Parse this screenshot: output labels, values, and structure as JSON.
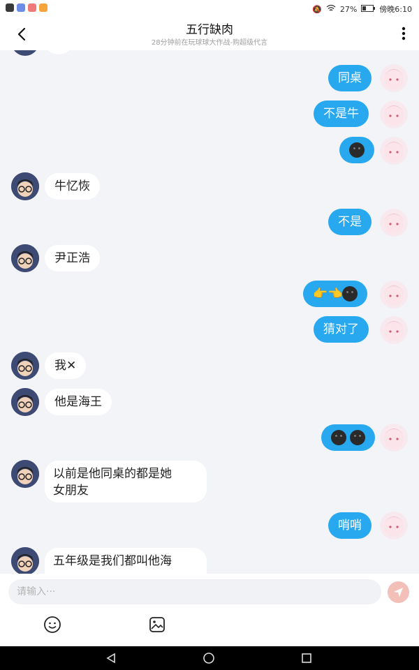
{
  "status_bar": {
    "battery": "27%",
    "clock": "傍晚6:10"
  },
  "header": {
    "title": "五行缺肉",
    "subtitle": "28分钟前在玩球球大作战-购超级代言"
  },
  "messages": [
    {
      "side": "right",
      "text": "同桌"
    },
    {
      "side": "right",
      "text": "不是牛"
    },
    {
      "side": "right",
      "text": "",
      "emoji": [
        "dark-face"
      ]
    },
    {
      "side": "left",
      "text": "牛忆恢"
    },
    {
      "side": "right",
      "text": "不是"
    },
    {
      "side": "left",
      "text": "尹正浩"
    },
    {
      "side": "right",
      "text": "👉👈",
      "emoji": [
        "dark-face"
      ]
    },
    {
      "side": "right",
      "text": "猜对了"
    },
    {
      "side": "left",
      "text": "我✕"
    },
    {
      "side": "left",
      "text": "他是海王"
    },
    {
      "side": "right",
      "text": "",
      "emoji": [
        "dark-face",
        "dark-face"
      ]
    },
    {
      "side": "left",
      "text": "以前是他同桌的都是她",
      "text2": "女朋友"
    },
    {
      "side": "right",
      "text": "哨哨"
    },
    {
      "side": "left",
      "text": "五年级是我们都叫他海"
    }
  ],
  "input": {
    "placeholder": "请输入···"
  },
  "icons": {
    "back": "back-arrow-icon",
    "more": "more-vertical-icon",
    "send": "send-icon",
    "emoji": "emoji-icon",
    "image": "image-icon"
  },
  "colors": {
    "accent": "#27a8ef",
    "send_disabled": "#f2c0b8"
  }
}
